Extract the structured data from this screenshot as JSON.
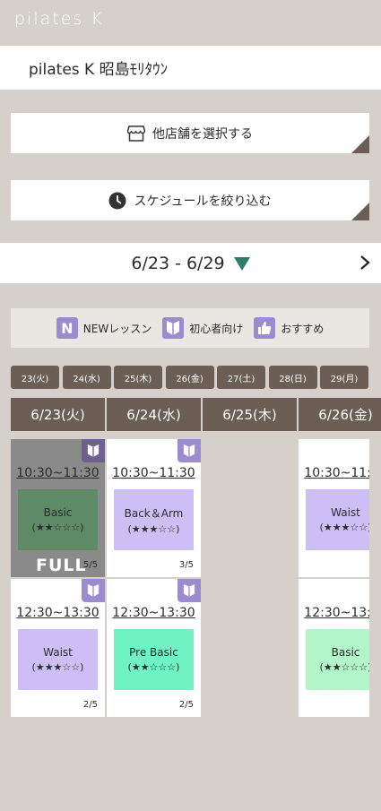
{
  "brand": {
    "logo_text": "pilates K"
  },
  "store": {
    "name": "pilates K 昭島ﾓﾘﾀｳﾝ"
  },
  "actions": {
    "select_store_label": "他店舗を選択する",
    "filter_schedule_label": "スケジュールを絞り込む"
  },
  "week": {
    "range": "6/23 - 6/29"
  },
  "legend": {
    "new_label": "NEWレッスン",
    "new_glyph": "N",
    "beginner_label": "初心者向け",
    "recommend_label": "おすすめ"
  },
  "day_tabs": [
    "23(火)",
    "24(水)",
    "25(木)",
    "26(金)",
    "27(土)",
    "28(日)",
    "29(月)"
  ],
  "day_headers": [
    "6/23(火)",
    "6/24(水)",
    "6/25(木)",
    "6/26(金)"
  ],
  "cards": [
    {
      "time": "10:30~11:30",
      "name": "Basic",
      "stars": "(★★☆☆☆)",
      "count": "5/5",
      "full_label": "FULL",
      "lesson_color": "#5e8a66"
    },
    {
      "time": "10:30~11:30",
      "name": "Back＆Arm",
      "stars": "(★★★☆☆)",
      "count": "3/5",
      "lesson_color": "#cdbff5"
    },
    {
      "time": "10:30~11:30",
      "name": "Waist",
      "stars": "(★★★☆☆)",
      "count": "",
      "lesson_color": "#cdbff5"
    },
    {
      "time": "12:30~13:30",
      "name": "Waist",
      "stars": "(★★★☆☆)",
      "count": "2/5",
      "lesson_color": "#cdbff5"
    },
    {
      "time": "12:30~13:30",
      "name": "Pre Basic",
      "stars": "(★★☆☆☆)",
      "count": "2/5",
      "lesson_color": "#6ff2c4"
    },
    {
      "time": "12:30~13:30",
      "name": "Basic",
      "stars": "(★★☆☆☆)",
      "count": "",
      "lesson_color": "#b2f5c8"
    }
  ],
  "colors": {
    "accent_dark": "#6b5f55",
    "badge_purple": "#9b8bcf",
    "triangle_green": "#2f7a6a",
    "background": "#d5d0ca"
  }
}
